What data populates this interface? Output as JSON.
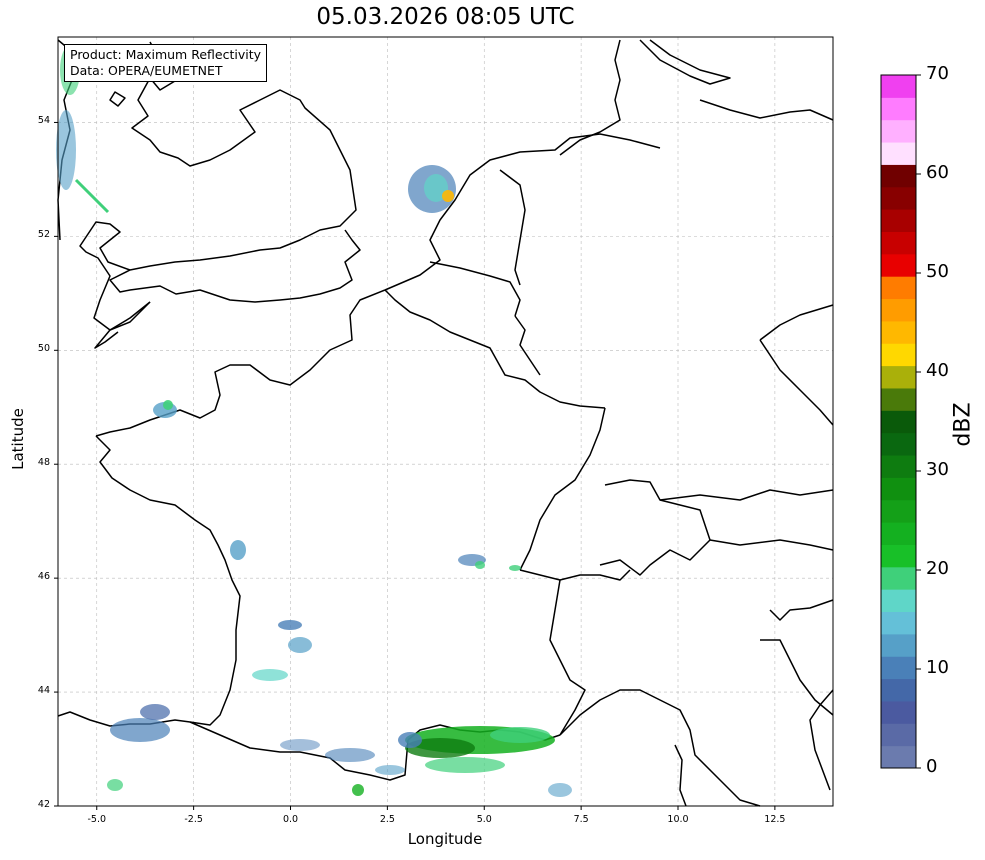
{
  "title": "05.03.2026 08:05 UTC",
  "info": {
    "line1": "Product: Maximum Reflectivity",
    "line2": "Data: OPERA/EUMETNET"
  },
  "axes": {
    "xlabel": "Longitude",
    "ylabel": "Latitude",
    "xlim": [
      -6,
      14
    ],
    "ylim": [
      42,
      55.5
    ],
    "xticks": [
      "-5.0",
      "-2.5",
      "0.0",
      "2.5",
      "5.0",
      "7.5",
      "10.0",
      "12.5"
    ],
    "xtick_values": [
      -5,
      -2.5,
      0,
      2.5,
      5,
      7.5,
      10,
      12.5
    ],
    "yticks": [
      "42",
      "44",
      "46",
      "48",
      "50",
      "52",
      "54"
    ],
    "ytick_values": [
      42,
      44,
      46,
      48,
      50,
      52,
      54
    ],
    "grid": true
  },
  "colorbar": {
    "label": "dBZ",
    "ticks": [
      "0",
      "10",
      "20",
      "30",
      "40",
      "50",
      "60",
      "70"
    ],
    "tick_values": [
      0,
      10,
      20,
      30,
      40,
      50,
      60,
      70
    ],
    "colors": [
      "#6b7bae",
      "#5a6aa6",
      "#4b5aa0",
      "#4468a8",
      "#4a80b8",
      "#56a0c8",
      "#64c0d8",
      "#5fd6c8",
      "#3fd07a",
      "#18c028",
      "#14b020",
      "#14a018",
      "#109010",
      "#0e7c10",
      "#0a6810",
      "#0a5a0a",
      "#4a7a0a",
      "#aab00a",
      "#ffd800",
      "#ffb800",
      "#ff9c00",
      "#ff7c00",
      "#e80000",
      "#c80000",
      "#a80000",
      "#880000",
      "#700000",
      "#ffe0ff",
      "#ffb0ff",
      "#ff7cff",
      "#f040f0"
    ]
  },
  "chart_data": {
    "type": "heatmap",
    "title": "05.03.2026 08:05 UTC",
    "xlabel": "Longitude",
    "ylabel": "Latitude",
    "xlim": [
      -6,
      14
    ],
    "ylim": [
      42,
      55.5
    ],
    "colorbar_label": "dBZ",
    "colorbar_range": [
      0,
      70
    ],
    "echo_regions": [
      {
        "lon": 4.0,
        "lat": 43.0,
        "max_dbz": 28
      },
      {
        "lon": 5.5,
        "lat": 43.3,
        "max_dbz": 25
      },
      {
        "lon": 3.5,
        "lat": 52.8,
        "max_dbz": 45
      },
      {
        "lon": -3.0,
        "lat": 43.0,
        "max_dbz": 12
      },
      {
        "lon": -1.3,
        "lat": 46.4,
        "max_dbz": 12
      },
      {
        "lon": -3.2,
        "lat": 48.8,
        "max_dbz": 12
      },
      {
        "lon": 0.3,
        "lat": 44.8,
        "max_dbz": 10
      },
      {
        "lon": 5.0,
        "lat": 46.3,
        "max_dbz": 18
      },
      {
        "lon": -5.5,
        "lat": 54.5,
        "max_dbz": 15
      }
    ]
  }
}
